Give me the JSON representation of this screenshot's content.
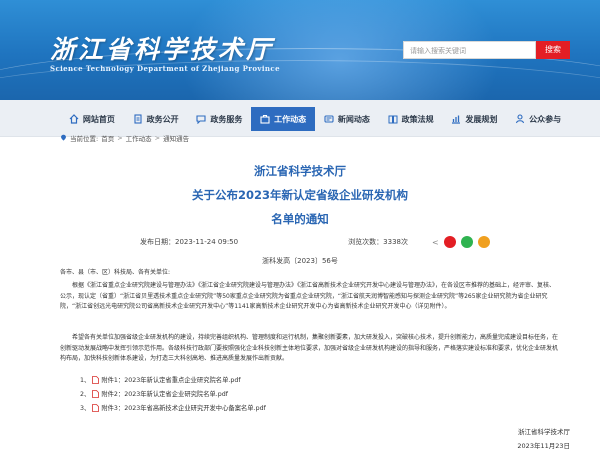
{
  "header": {
    "logo_cn": "浙江省科学技术厅",
    "logo_en": "Science Technology Department of Zhejiang Province",
    "search_placeholder": "请输入搜索关键词",
    "search_button": "搜索"
  },
  "nav": {
    "items": [
      {
        "label": "网站首页",
        "icon": "home-icon"
      },
      {
        "label": "政务公开",
        "icon": "document-icon"
      },
      {
        "label": "政务服务",
        "icon": "chat-icon"
      },
      {
        "label": "工作动态",
        "icon": "briefcase-icon",
        "active": true
      },
      {
        "label": "新闻动态",
        "icon": "news-icon"
      },
      {
        "label": "政策法规",
        "icon": "book-icon"
      },
      {
        "label": "发展规划",
        "icon": "chart-icon"
      },
      {
        "label": "公众参与",
        "icon": "people-icon"
      }
    ]
  },
  "breadcrumb": {
    "prefix": "当前位置:",
    "items": [
      "首页",
      "工作动态",
      "通知通告"
    ],
    "separator": ">"
  },
  "article": {
    "title_lines": [
      "浙江省科学技术厅",
      "关于公布2023年新认定省级企业研发机构",
      "名单的通知"
    ],
    "publish_label": "发布日期：",
    "publish_time": "2023-11-24 09:50",
    "views_label": "浏览次数：",
    "views": "3338次",
    "doc_no": "浙科发高〔2023〕56号",
    "salutation": "各市、县（市、区）科技局、各有关单位:",
    "paragraph1": "根据《浙江省重点企业研究院建设与管理办法》《浙江省企业研究院建设与管理办法》《浙江省高新技术企业研究开发中心建设与管理办法》，在各设区市推荐的基础上，经评审、复核、公示，现认定（省重）“浙江省贝里透技术重点企业研究院”等50家重点企业研究院为省重点企业研究院，“浙江省航天润博智能感知与探测企业研究院”等265家企业研究院为省企业研究院，“浙江省创远光电研究院公司省高新技术企业研究开发中心”等1141家高新技术企业研究开发中心为省高新技术企业研究开发中心（详见附件）。",
    "paragraph2": "希望各有关单位加强省级企业研发机构的建设，持续完善组织机构、管理制度和运行机制，集聚创新要素，加大研发投入，突破核心技术，提升创新能力，高质量完成建设目标任务，在创新驱动发展战略中发挥引领示范作用。各级科技行政部门要按照强化企业科技创新主体地位要求，加强对省级企业研发机构建设的指导和服务，严格落实建设标准和要求，优化企业研发机构布局，加快科技创新体系建设，为打造三大科创高地、推进高质量发展作出新贡献。",
    "attachments": [
      {
        "index": "1、",
        "label": "附件1：2023年新认定省重点企业研究院名单.pdf"
      },
      {
        "index": "2、",
        "label": "附件2：2023年新认定省企业研究院名单.pdf"
      },
      {
        "index": "3、",
        "label": "附件3：2023年省高新技术企业研究开发中心备案名单.pdf"
      }
    ],
    "sign_org": "浙江省科学技术厅",
    "sign_date": "2023年11月23日"
  },
  "colors": {
    "banner": "#1f74bf",
    "nav_active": "#2e6cc0",
    "title": "#2a66b3",
    "search_button": "#e31e24",
    "share": [
      "#e8e8e8",
      "#e31e24",
      "#2fb350",
      "#f0a020"
    ]
  }
}
